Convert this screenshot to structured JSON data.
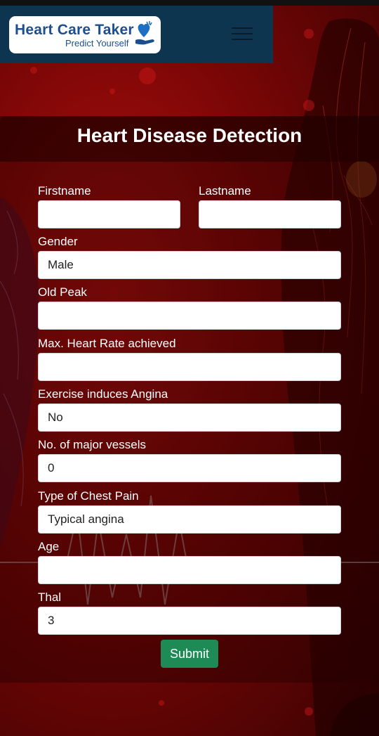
{
  "brand": {
    "title": "Heart Care Taker",
    "subtitle": "Predict Yourself"
  },
  "page_title": "Heart Disease Detection",
  "form": {
    "firstname": {
      "label": "Firstname",
      "value": ""
    },
    "lastname": {
      "label": "Lastname",
      "value": ""
    },
    "gender": {
      "label": "Gender",
      "value": "Male"
    },
    "old_peak": {
      "label": "Old Peak",
      "value": ""
    },
    "max_heart_rate": {
      "label": "Max. Heart Rate achieved",
      "value": ""
    },
    "exercise_angina": {
      "label": "Exercise induces Angina",
      "value": "No"
    },
    "major_vessels": {
      "label": "No. of major vessels",
      "value": "0"
    },
    "chest_pain": {
      "label": "Type of Chest Pain",
      "value": "Typical angina"
    },
    "age": {
      "label": "Age",
      "value": ""
    },
    "thal": {
      "label": "Thal",
      "value": "3"
    },
    "submit_label": "Submit"
  },
  "icons": {
    "menu": "hamburger-icon",
    "logo": "heart-hand-icon"
  },
  "colors": {
    "navbar": "#0e3550",
    "brand_text": "#1d4f8f",
    "submit": "#1e8a56",
    "background": "#8a0808"
  }
}
